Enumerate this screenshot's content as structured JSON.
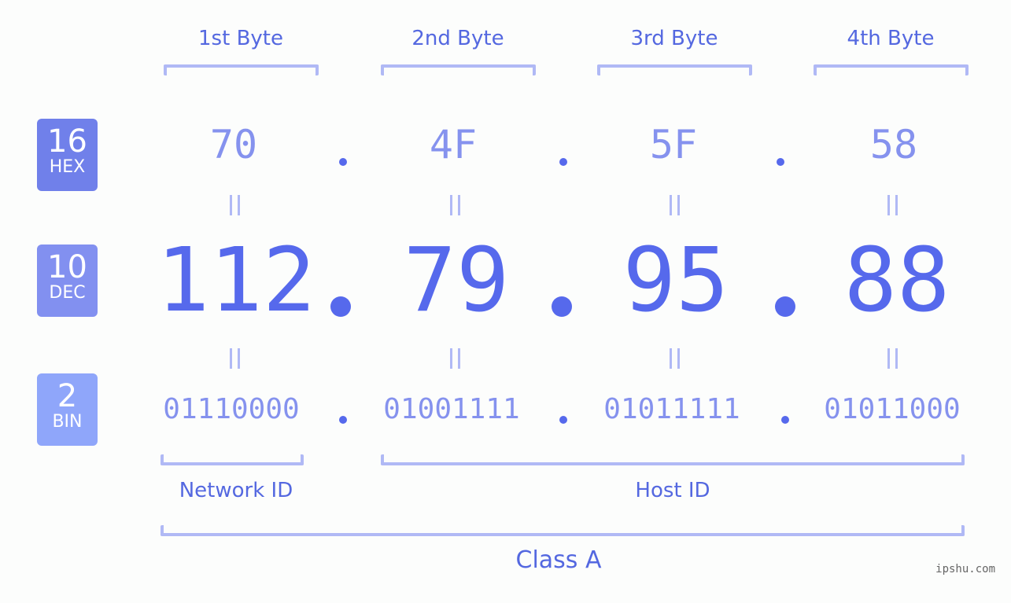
{
  "byte_headers": [
    "1st Byte",
    "2nd Byte",
    "3rd Byte",
    "4th Byte"
  ],
  "bases": [
    {
      "num": "16",
      "label": "HEX",
      "color": "#7080ea"
    },
    {
      "num": "10",
      "label": "DEC",
      "color": "#8290f0"
    },
    {
      "num": "2",
      "label": "BIN",
      "color": "#8fa6fa"
    }
  ],
  "hex": [
    "70",
    "4F",
    "5F",
    "58"
  ],
  "dec": [
    "112",
    "79",
    "95",
    "88"
  ],
  "bin": [
    "01110000",
    "01001111",
    "01011111",
    "01011000"
  ],
  "network_id_label": "Network ID",
  "host_id_label": "Host ID",
  "class_label": "Class A",
  "watermark": "ipshu.com",
  "colors": {
    "accent": "#5669ec",
    "light_accent": "#8592ee",
    "bracket": "#b0b9f5"
  }
}
